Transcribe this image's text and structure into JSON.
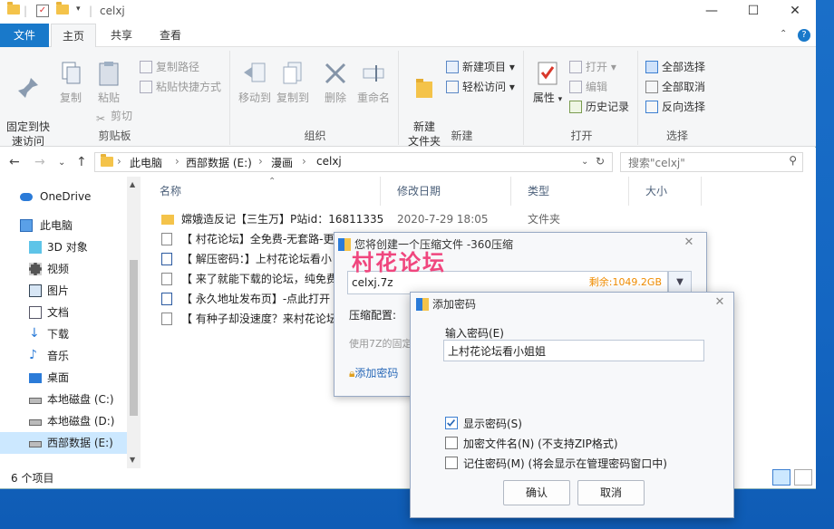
{
  "window": {
    "title": "celxj",
    "min": "—",
    "max": "☐",
    "close": "✕"
  },
  "menu": {
    "file": "文件",
    "home": "主页",
    "share": "共享",
    "view": "查看"
  },
  "ribbon": {
    "clipboard": {
      "label": "剪贴板",
      "pin": "固定到快\n速访问",
      "copy": "复制",
      "paste": "粘贴",
      "copy_path": "复制路径",
      "paste_shortcut": "粘贴快捷方式",
      "cut": "剪切"
    },
    "organize": {
      "label": "组织",
      "move_to": "移动到",
      "copy_to": "复制到",
      "delete": "删除",
      "rename": "重命名"
    },
    "new": {
      "label": "新建",
      "new_folder": "新建\n文件夹",
      "new_item": "新建项目",
      "easy_access": "轻松访问"
    },
    "open": {
      "label": "打开",
      "properties": "属性",
      "open": "打开",
      "edit": "编辑",
      "history": "历史记录"
    },
    "select": {
      "label": "选择",
      "select_all": "全部选择",
      "select_none": "全部取消",
      "invert": "反向选择"
    }
  },
  "address": {
    "crumbs": [
      "此电脑",
      "西部数据 (E:)",
      "漫画",
      "celxj"
    ],
    "search_placeholder": "搜索\"celxj\""
  },
  "nav": [
    "OneDrive",
    "此电脑",
    "3D 对象",
    "视频",
    "图片",
    "文档",
    "下载",
    "音乐",
    "桌面",
    "本地磁盘 (C:)",
    "本地磁盘 (D:)",
    "西部数据 (E:)"
  ],
  "columns": {
    "name": "名称",
    "date": "修改日期",
    "type": "类型",
    "size": "大小"
  },
  "files": [
    {
      "name": "嫦娥造反记【三生万】P站id：16811335",
      "date": "2020-7-29 18:05",
      "type": "文件夹"
    },
    {
      "name": "【 村花论坛】全免费-无套路-更新",
      "date": "",
      "type": ""
    },
    {
      "name": "【 解压密码：】上村花论坛看小",
      "date": "",
      "type": ""
    },
    {
      "name": "【 来了就能下载的论坛，纯免费",
      "date": "",
      "type": ""
    },
    {
      "name": "【 永久地址发布页】-点此打开",
      "date": "",
      "type": ""
    },
    {
      "name": "【 有种子却没速度？来村花论坛",
      "date": "",
      "type": ""
    }
  ],
  "status": {
    "count": "6 个项目"
  },
  "dlg360": {
    "title": "您将创建一个压缩文件 -360压缩",
    "path": "celxj.7z",
    "free": "剩余:1049.2GB",
    "config_label": "压缩配置:",
    "hint": "使用7Z的固定",
    "add_pwd": "添加密码"
  },
  "watermark": "村花论坛",
  "pwd_dialog": {
    "title": "添加密码",
    "input_label": "输入密码(E)",
    "password": "上村花论坛看小姐姐",
    "show_pwd": "显示密码(S)",
    "encrypt_names": "加密文件名(N) (不支持ZIP格式)",
    "remember": "记住密码(M) (将会显示在管理密码窗口中)",
    "ok": "确认",
    "cancel": "取消",
    "show_pwd_checked": true,
    "encrypt_names_checked": false,
    "remember_checked": false
  }
}
